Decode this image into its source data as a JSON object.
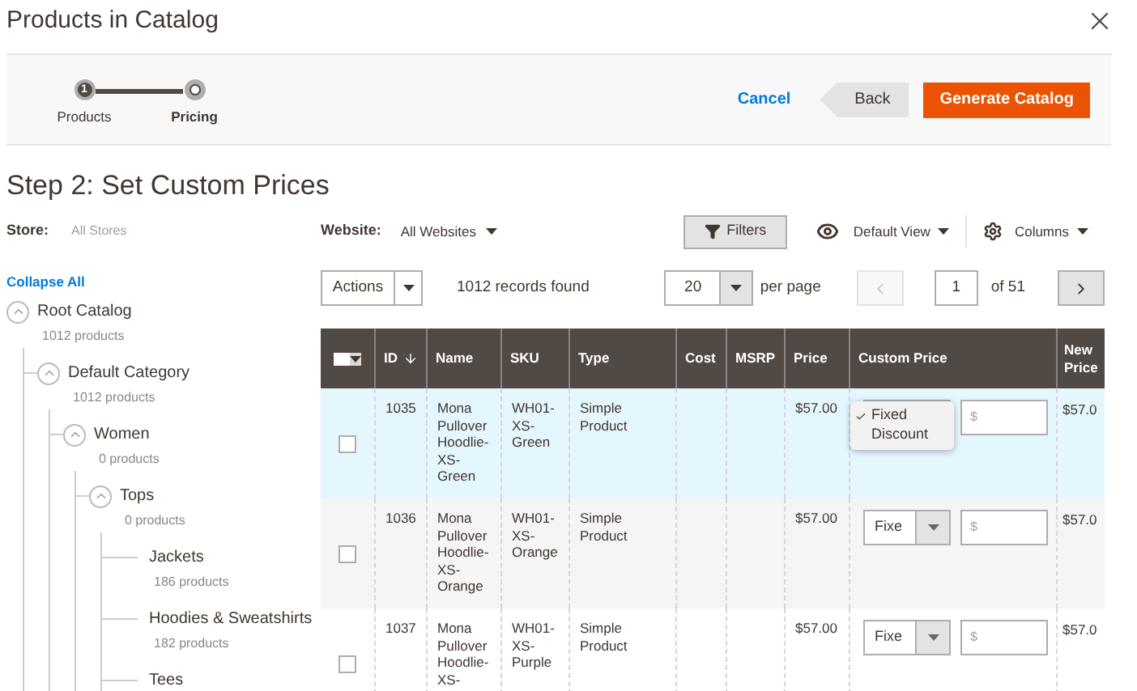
{
  "window": {
    "title": "Products in Catalog"
  },
  "steps": [
    {
      "label": "Products",
      "number": "1",
      "current": false
    },
    {
      "label": "Pricing",
      "current": true
    }
  ],
  "actions": {
    "cancel": "Cancel",
    "back": "Back",
    "primary": "Generate Catalog"
  },
  "heading": "Step 2: Set Custom Prices",
  "store": {
    "label": "Store:",
    "value": "All Stores"
  },
  "website": {
    "label": "Website:",
    "value": "All Websites"
  },
  "filters_button": "Filters",
  "view_menu": "Default View",
  "columns_menu": "Columns",
  "collapse_all": "Collapse All",
  "tree": [
    {
      "label": "Root Catalog",
      "count": "1012 products",
      "expanded": true,
      "children": [
        {
          "label": "Default Category",
          "count": "1012 products",
          "expanded": true,
          "children": [
            {
              "label": "Women",
              "count": "0 products",
              "expanded": true,
              "children": [
                {
                  "label": "Tops",
                  "count": "0 products",
                  "expanded": true,
                  "children": [
                    {
                      "label": "Jackets",
                      "count": "186 products"
                    },
                    {
                      "label": "Hoodies & Sweatshirts",
                      "count": "182 products"
                    },
                    {
                      "label": "Tees"
                    }
                  ]
                }
              ]
            }
          ]
        }
      ]
    }
  ],
  "grid": {
    "actions": "Actions",
    "records": "1012 records found",
    "page_size": "20",
    "per_page": "per page",
    "page": "1",
    "page_total": "of 51",
    "prev_disabled": true,
    "next_disabled": false,
    "columns": [
      {
        "label": "ID",
        "sorted": true
      },
      {
        "label": "Name",
        "sorted": false
      },
      {
        "label": "SKU",
        "sorted": false
      },
      {
        "label": "Type",
        "sorted": false
      },
      {
        "label": "Cost",
        "sorted": false
      },
      {
        "label": "MSRP",
        "sorted": false
      },
      {
        "label": "Price",
        "sorted": false
      },
      {
        "label": "Custom Price",
        "sorted": false
      },
      {
        "label": "New Price",
        "sorted": false
      }
    ],
    "rows": [
      {
        "id": "1035",
        "name": "Mona Pullover Hoodlie-XS-Green",
        "sku": "WH01-XS-Green",
        "type": "Simple Product",
        "price": "$57.00",
        "highlighted": true,
        "checked": false,
        "open": true,
        "menu": [
          {
            "label": "Fixed",
            "selected": true
          },
          {
            "label": "Discount",
            "selected": false
          }
        ],
        "placeholder": "$",
        "new_price": "$57.0"
      },
      {
        "id": "1036",
        "name": "Mona Pullover Hoodlie-XS-Orange",
        "sku": "WH01-XS-Orange",
        "type": "Simple Product",
        "price": "$57.00",
        "highlighted": false,
        "checked": false,
        "open": false,
        "select_value": "Fixe",
        "placeholder": "$",
        "new_price": "$57.0"
      },
      {
        "id": "1037",
        "name": "Mona Pullover Hoodlie-XS-",
        "sku": "WH01-XS-Purple",
        "type": "Simple Product",
        "price": "$57.00",
        "highlighted": false,
        "checked": false,
        "open": false,
        "select_value": "Fixe",
        "placeholder": "$",
        "new_price": "$57.0"
      }
    ]
  }
}
